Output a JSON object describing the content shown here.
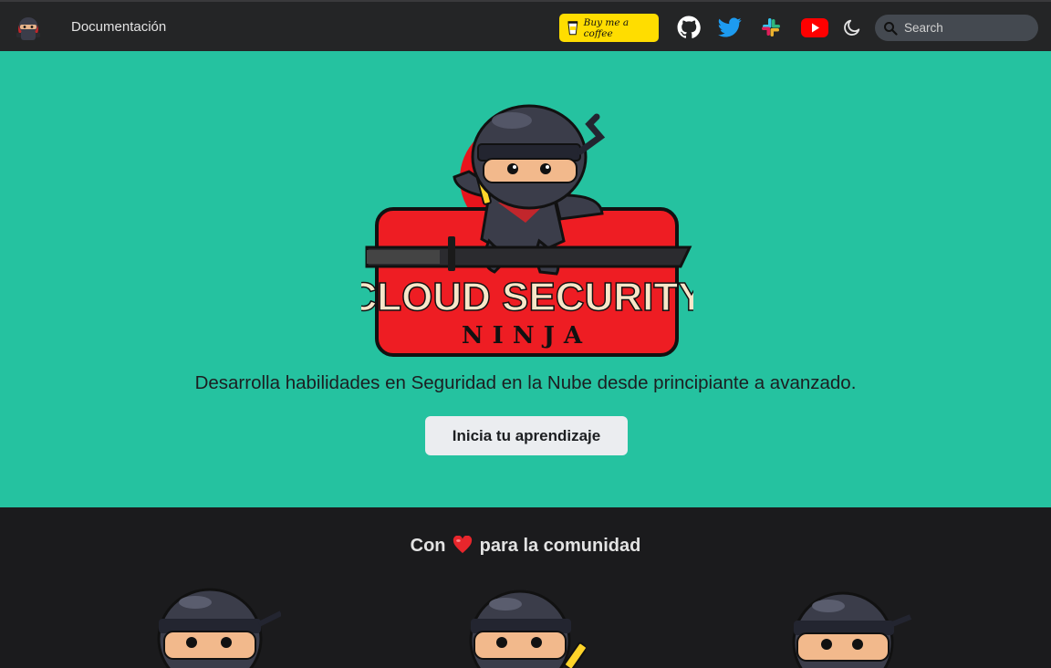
{
  "navbar": {
    "logo_icon": "ninja-logo-icon",
    "doc_link": "Documentación",
    "coffee_label": "Buy me a coffee",
    "icons": [
      "github-icon",
      "twitter-icon",
      "slack-icon",
      "youtube-icon",
      "moon-icon"
    ],
    "search_placeholder": "Search"
  },
  "hero": {
    "background": "#25c2a0",
    "logo_line1": "CLOUD SECURITY",
    "logo_line2": "NINJA",
    "tagline": "Desarrolla habilidades en Seguridad en la Nube desde principiante a avanzado.",
    "cta_label": "Inicia tu aprendizaje"
  },
  "community": {
    "title_before": "Con",
    "title_after": "para la comunidad"
  }
}
